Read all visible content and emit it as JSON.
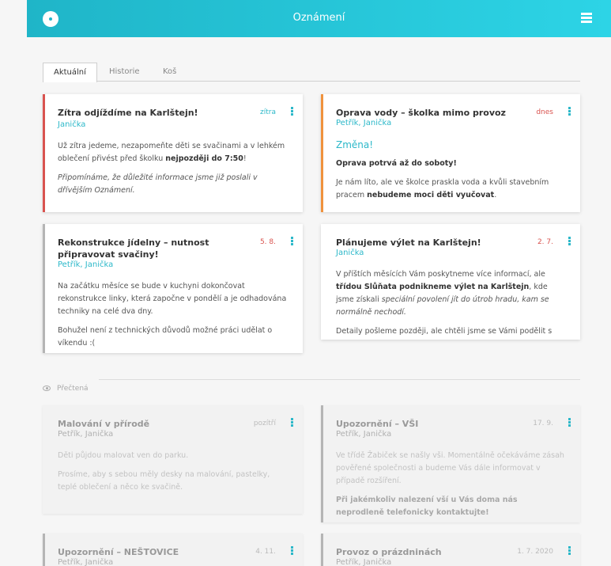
{
  "header": {
    "title": "Oznámení"
  },
  "tabs": [
    {
      "label": "Aktuální"
    },
    {
      "label": "Historie"
    },
    {
      "label": "Koš"
    }
  ],
  "colors": {
    "accent": "#2cb8c9",
    "red_bar": "#d9534f",
    "orange_bar": "#f0923d",
    "gray_bar": "#b5b5b5"
  },
  "cards": {
    "c1": {
      "title": "Zítra odjíždíme na Karlštejn!",
      "date": "zítra",
      "authors": "Janička",
      "p1a": "Už zítra jedeme, nezapomeňte děti se svačinami a v lehkém oblečení přivést před školku ",
      "p1b": "nejpozději do 7:50",
      "p1c": "!",
      "p2": "Připomínáme, že důležité informace jsme již poslali v dřívějším Oznámení."
    },
    "c2": {
      "title": "Oprava vody – školka mimo provoz",
      "date": "dnes",
      "authors": "Petřík, Janička",
      "change": "Změna!",
      "p1": "Oprava potrvá až do soboty!",
      "p2a": "Je nám líto, ale ve školce praskla voda a kvůli stavebním pracem ",
      "p2b": "nebudeme moci děti vyučovat",
      "p2c": "."
    },
    "c3": {
      "title": "Rekonstrukce jídelny – nutnost připravovat svačiny!",
      "date": "5. 8.",
      "authors": "Petřík, Janička",
      "p1": "Na začátku měsíce se bude v kuchyni dokončovat rekonstrukce linky, která započne v pondělí a je odhadována techniky na celé dva dny.",
      "p2": "Bohužel není z technických důvodů možné práci udělat o víkendu :("
    },
    "c4": {
      "title": "Plánujeme výlet na Karlštejn!",
      "date": "2. 7.",
      "authors": "Janička",
      "p1a": "V příštích měsících Vám poskytneme více informací, ale ",
      "p1b": "třídou Slůňata podnikneme výlet na Karlštejn",
      "p1c": ", kde jsme získali ",
      "p1d": "speciální povolení jít do útrob hradu, kam se normálně nechodí.",
      "p2": "Detaily pošleme později, ale chtěli jsme se Vámi podělit s"
    }
  },
  "read_label": "Přečtená",
  "read_cards": {
    "r1": {
      "title": "Malování v přírodě",
      "date": "pozítří",
      "authors": "Petřík, Janička",
      "p1": "Děti půjdou malovat ven do parku.",
      "p2": "Prosíme, aby s sebou měly desky na malování, pastelky, teplé oblečení a něco ke svačině."
    },
    "r2": {
      "title": "Upozornění – VŠI",
      "date": "17. 9.",
      "authors": "Petřík, Janička",
      "p1": "Ve třídě Žabiček se našly vši. Momentálně očekáváme zásah pověřené společnosti a budeme Vás dále informovat v případě rozšíření.",
      "p2": "Při jakémkoliv nalezení vší u Vás doma nás neprodleně telefonicky kontaktujte!"
    },
    "r3": {
      "title": "Upozornění – NEŠTOVICE",
      "date": "4. 11.",
      "authors": "Petřík, Janička"
    },
    "r4": {
      "title": "Provoz o prázdninách",
      "date": "1. 7. 2020",
      "authors": "Petřík, Janička"
    }
  }
}
